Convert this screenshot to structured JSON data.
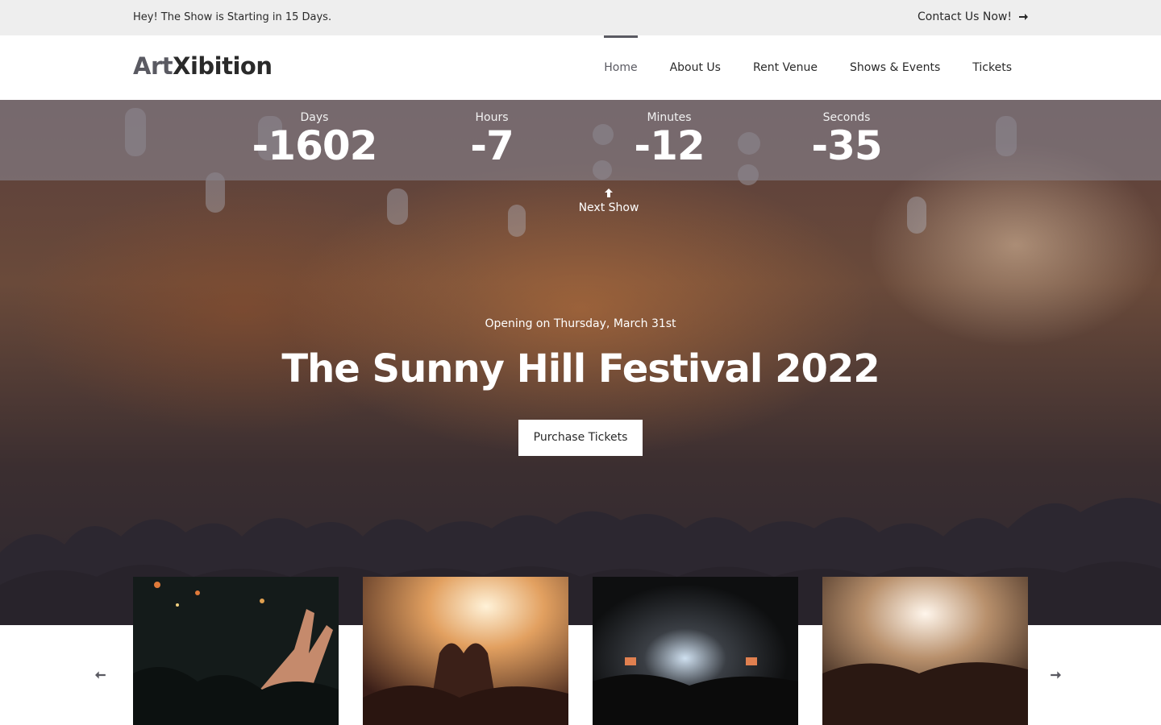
{
  "topbar": {
    "message": "Hey! The Show is Starting in 15 Days.",
    "contact": "Contact Us Now!",
    "contact_icon": "arrow-right-icon"
  },
  "header": {
    "logo_part1": "Art",
    "logo_part2": "Xibition",
    "nav": [
      {
        "label": "Home",
        "active": true
      },
      {
        "label": "About Us"
      },
      {
        "label": "Rent Venue"
      },
      {
        "label": "Shows & Events"
      },
      {
        "label": "Tickets"
      }
    ]
  },
  "countdown": [
    {
      "label": "Days",
      "value": "-1602"
    },
    {
      "label": "Hours",
      "value": "-7"
    },
    {
      "label": "Minutes",
      "value": "-12"
    },
    {
      "label": "Seconds",
      "value": "-35"
    }
  ],
  "hero": {
    "next_show": "Next Show",
    "next_show_icon": "arrow-up-icon",
    "subtitle": "Opening on Thursday, March 31st",
    "title": "The Sunny Hill Festival 2022",
    "cta": "Purchase Tickets"
  },
  "gallery": {
    "prev_icon": "arrow-left-icon",
    "next_icon": "arrow-right-icon",
    "images": [
      "concert-photo-hands",
      "concert-photo-heart-hands",
      "concert-photo-confetti",
      "concert-photo-stage-lights"
    ]
  },
  "colors": {
    "accent": "#5a5a62",
    "topbar_bg": "#eeeeee",
    "text_dark": "#2a2a2a"
  }
}
